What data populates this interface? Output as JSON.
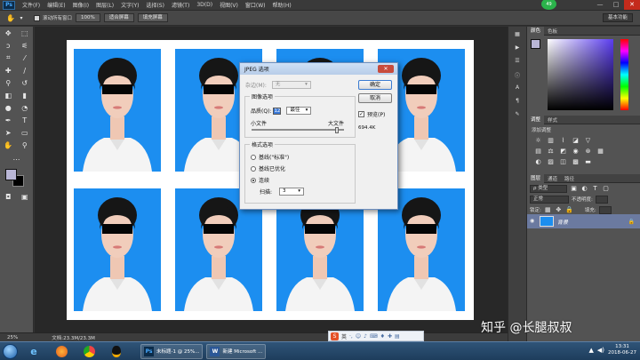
{
  "app": {
    "logo": "Ps",
    "menu": [
      "文件(F)",
      "编辑(E)",
      "图像(I)",
      "图层(L)",
      "文字(Y)",
      "选择(S)",
      "滤镜(T)",
      "3D(D)",
      "视图(V)",
      "窗口(W)",
      "帮助(H)"
    ],
    "notification_count": "49",
    "window_controls": [
      "—",
      "□",
      "✕"
    ]
  },
  "options_bar": {
    "scroll_all_label": "滚动所有窗口",
    "zoom_value": "100%",
    "fit_screen_label": "适合屏幕",
    "fill_screen_label": "填充屏幕",
    "workspace": "基本功能"
  },
  "status_bar": {
    "zoom": "25%",
    "doc_info": "文档:23.3M/23.3M"
  },
  "dialog": {
    "title": "JPEG 选项",
    "matte_label": "杂边(M):",
    "matte_value": "无",
    "image_options_title": "图像选项",
    "quality_label": "品质(Q):",
    "quality_value": "12",
    "quality_preset": "最佳",
    "small_file_label": "小文件",
    "large_file_label": "大文件",
    "quality_fraction": 0.92,
    "format_options_title": "格式选项",
    "format_options": [
      {
        "label": "基线(\"标准\")",
        "selected": false
      },
      {
        "label": "基线已优化",
        "selected": false
      },
      {
        "label": "连续",
        "selected": true
      }
    ],
    "scans_label": "扫描:",
    "scans_value": "3",
    "ok_label": "确定",
    "cancel_label": "取消",
    "preview_label": "预览(P)",
    "preview_checked": true,
    "file_size": "694.4K"
  },
  "panels": {
    "color_tabs": [
      "颜色",
      "色板"
    ],
    "adjust_tabs": [
      "调整",
      "样式"
    ],
    "adjust_title": "添加调整",
    "layers_tabs": [
      "图层",
      "通道",
      "路径"
    ],
    "kind_filter": "ρ 类型",
    "blend_mode": "正常",
    "opacity_label": "不透明度:",
    "lock_label": "锁定:",
    "fill_label": "填充:",
    "layer_name": "背景"
  },
  "canvas": {
    "photo_count": 8
  },
  "watermark": "知乎 @长腿叔叔",
  "ime": {
    "label": "英"
  },
  "taskbar": {
    "tasks": [
      {
        "icon": "Ps",
        "label": "未标题-1 @ 25%..."
      },
      {
        "icon": "W",
        "label": "新建 Microsoft ..."
      }
    ],
    "time": "13:31",
    "date": "2018-06-27"
  },
  "colors": {
    "photo_background": "#1c8ef0",
    "foreground_color": "#b9b6d6",
    "background_color": "#000000"
  }
}
